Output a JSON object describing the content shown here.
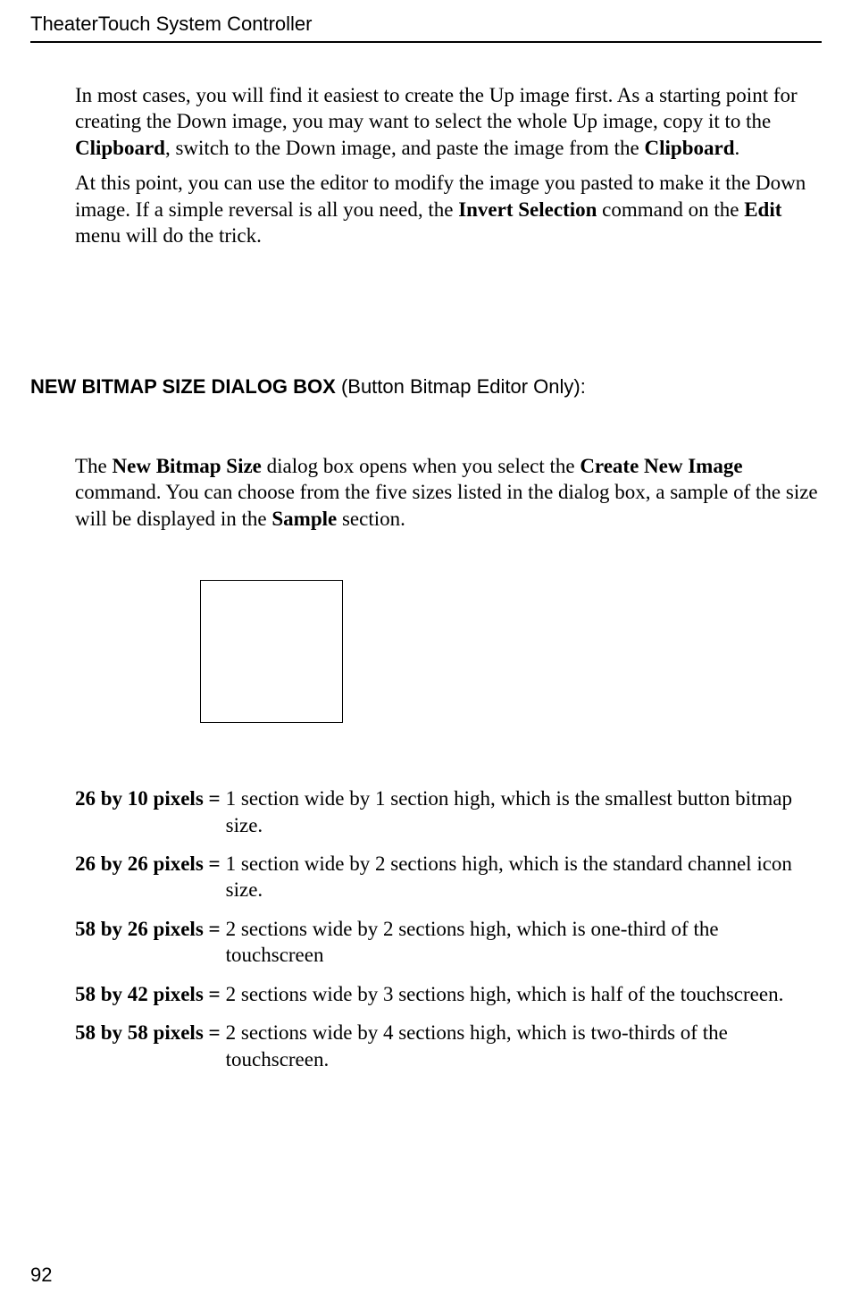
{
  "header": "TheaterTouch System Controller",
  "paragraphs": {
    "p1_a": "In most cases, you will find it easiest to create the Up image first.  As a starting point for creating the Down image, you may want to select the whole Up image, copy it to the ",
    "p1_b": "Clipboard",
    "p1_c": ", switch to the Down image, and paste the image from the ",
    "p1_d": "Clipboard",
    "p1_e": ".",
    "p2_a": "At this point, you can use the editor to modify the image you pasted to make it the Down image.  If a simple reversal is all you need, the ",
    "p2_b": "Invert Selection",
    "p2_c": " command on the ",
    "p2_d": "Edit",
    "p2_e": " menu will do the trick.",
    "p3_a": "The ",
    "p3_b": "New Bitmap Size",
    "p3_c": " dialog box opens when you select the ",
    "p3_d": "Create New Image",
    "p3_e": " command. You can choose from the five sizes listed in the dialog box, a sample of the size will be displayed in the ",
    "p3_f": "Sample",
    "p3_g": " section."
  },
  "section": {
    "title_bold": "NEW BITMAP SIZE DIALOG BOX",
    "title_rest": " (Button Bitmap Editor Only):"
  },
  "defs": [
    {
      "term": "26 by 10 pixels =",
      "desc": "1 section wide by 1 section high, which is the smallest button bitmap size."
    },
    {
      "term": "26 by 26 pixels =",
      "desc": "1 section wide by 2 sections high, which is the standard channel icon size."
    },
    {
      "term": "58 by 26 pixels =",
      "desc": "2 sections wide by 2 sections high, which is one-third of the touchscreen"
    },
    {
      "term": "58 by 42 pixels =",
      "desc": "2 sections wide by 3 sections high, which is half of the touchscreen."
    },
    {
      "term": "58 by 58 pixels =",
      "desc": "2 sections wide by 4 sections high, which is two-thirds of the touchscreen."
    }
  ],
  "pagenum": "92"
}
